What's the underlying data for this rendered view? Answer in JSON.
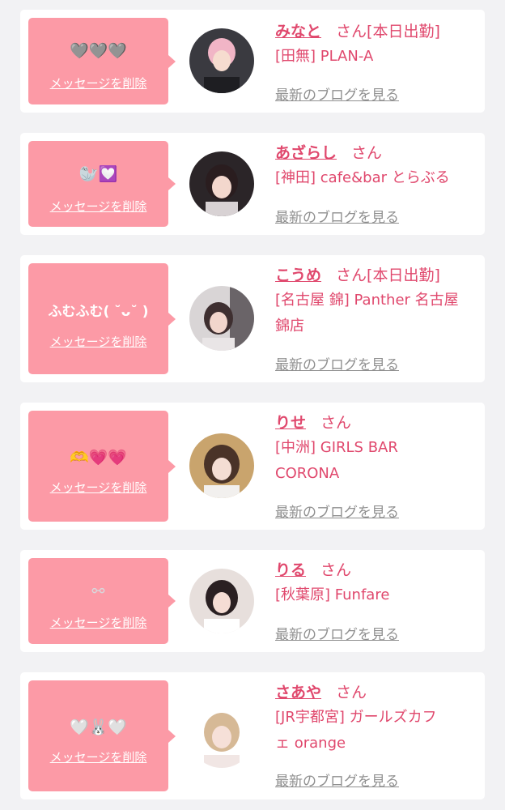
{
  "colors": {
    "page_bg": "#f2f2f4",
    "card_bg": "#ffffff",
    "bubble_bg": "#fc9aa6",
    "accent": "#e0486d",
    "blog_link": "#8f8f8f"
  },
  "cards": [
    {
      "message": "🩶🩶🩶",
      "delete_label": "メッセージを削除",
      "name": "みなと",
      "honorific": "さん",
      "status": "[本日出勤]",
      "shop_lines": [
        "[田無] PLAN-A"
      ],
      "blog_label": "最新のブログを見る"
    },
    {
      "message": "🦭💟",
      "delete_label": "メッセージを削除",
      "name": "あざらし",
      "honorific": "さん",
      "status": "",
      "shop_lines": [
        "[神田] cafe&bar とらぶる"
      ],
      "blog_label": "最新のブログを見る"
    },
    {
      "message": "ふむふむ( ˘ᴗ˘ )",
      "delete_label": "メッセージを削除",
      "name": "こうめ",
      "honorific": "さん",
      "status": "[本日出勤]",
      "shop_lines": [
        "[名古屋 錦] Panther 名古屋",
        "錦店"
      ],
      "blog_label": "最新のブログを見る"
    },
    {
      "message": "🫶💗💗",
      "delete_label": "メッセージを削除",
      "name": "りせ",
      "honorific": "さん",
      "status": "",
      "shop_lines": [
        "[中洲] GIRLS BAR",
        "CORONA"
      ],
      "blog_label": "最新のブログを見る"
    },
    {
      "message": "⚯",
      "delete_label": "メッセージを削除",
      "name": "りる",
      "honorific": "さん",
      "status": "",
      "shop_lines": [
        "[秋葉原] Funfare"
      ],
      "blog_label": "最新のブログを見る"
    },
    {
      "message": "🤍🐰🤍",
      "delete_label": "メッセージを削除",
      "name": "さあや",
      "honorific": "さん",
      "status": "",
      "shop_lines": [
        "[JR宇都宮] ガールズカフ",
        "ェ orange"
      ],
      "blog_label": "最新のブログを見る"
    }
  ]
}
